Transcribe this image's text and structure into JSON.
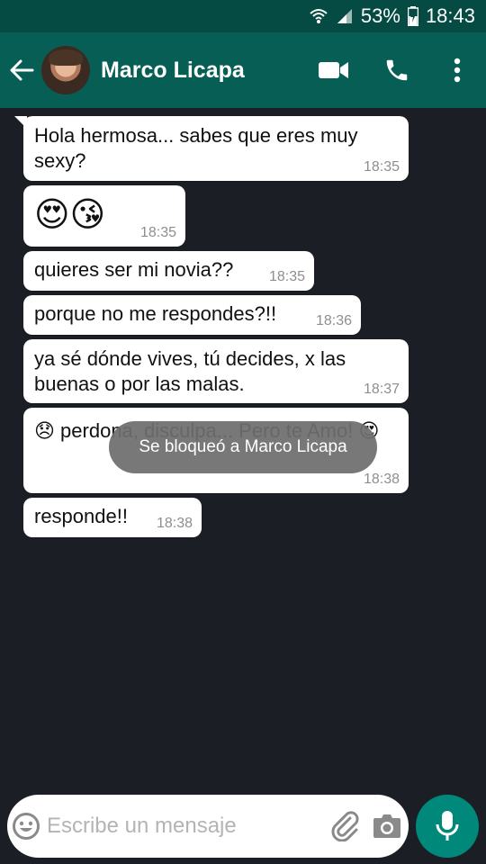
{
  "status_bar": {
    "battery": "53%",
    "time": "18:43",
    "icons": [
      "wifi-icon",
      "signal-icon",
      "battery-charging-icon"
    ]
  },
  "header": {
    "contact_name": "Marco Licapa",
    "icons": [
      "back-arrow-icon",
      "contact-avatar",
      "video-call-icon",
      "phone-call-icon",
      "more-vert-icon"
    ]
  },
  "messages": [
    {
      "text": "Hola hermosa... sabes que eres muy sexy?",
      "time": "18:35"
    },
    {
      "text": "😍😘",
      "time": "18:35"
    },
    {
      "text": "quieres ser mi novia??",
      "time": "18:35"
    },
    {
      "text": "porque no me respondes?!!",
      "time": "18:36"
    },
    {
      "text": "ya sé dónde vives, tú decides, x las buenas o por las malas.",
      "time": "18:37"
    },
    {
      "text": "😞 perdona, disculpa... Pero te Amo! 😍",
      "time": "18:38"
    },
    {
      "text": "responde!!",
      "time": "18:38"
    }
  ],
  "toast": {
    "text": "Se bloqueó a Marco Licapa"
  },
  "composer": {
    "placeholder": "Escribe un mensaje",
    "icons": [
      "emoji-icon",
      "attach-icon",
      "camera-icon",
      "mic-icon"
    ]
  },
  "colors": {
    "status_bar": "#054b43",
    "app_bar": "#075e54",
    "chat_background": "#1b1f25",
    "bubble": "#ffffff",
    "mic_button": "#00897b"
  }
}
